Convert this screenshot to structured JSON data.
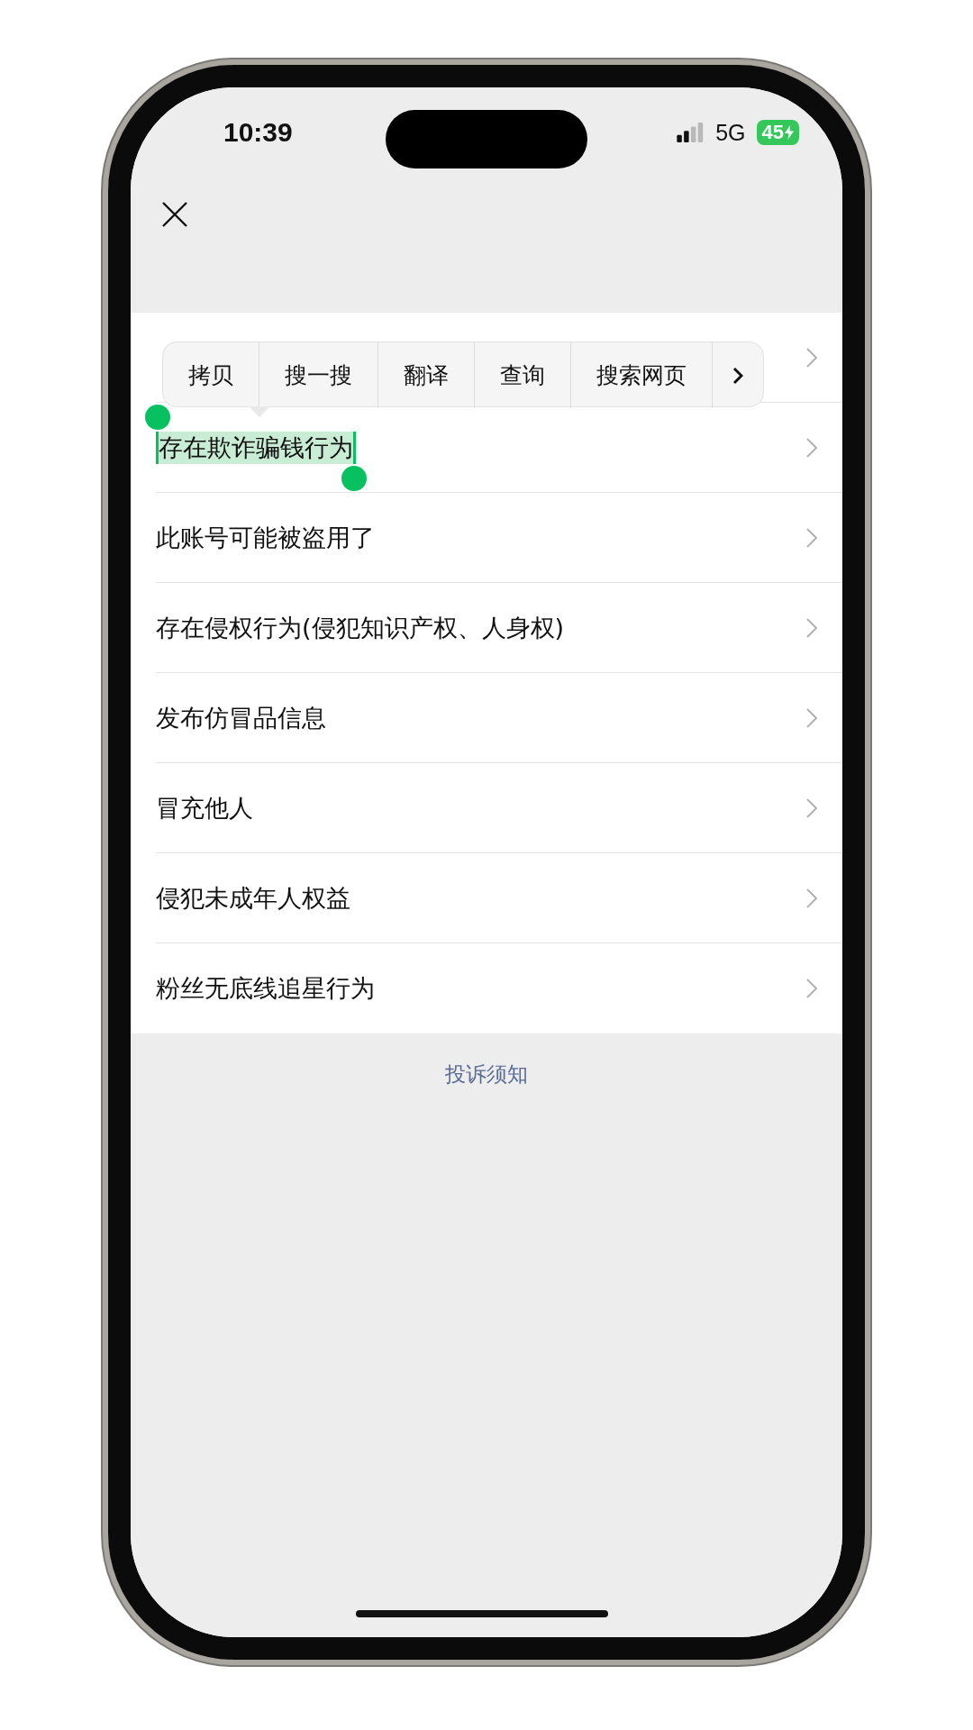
{
  "status_bar": {
    "time": "10:39",
    "network": "5G",
    "battery": "45"
  },
  "reasons": [
    {
      "selected": false
    },
    {
      "label": "存在欺诈骗钱行为",
      "selected": true
    },
    {
      "label": "此账号可能被盗用了",
      "selected": false
    },
    {
      "label": "存在侵权行为(侵犯知识产权、人身权)",
      "selected": false
    },
    {
      "label": "发布仿冒品信息",
      "selected": false
    },
    {
      "label": "冒充他人",
      "selected": false
    },
    {
      "label": "侵犯未成年人权益",
      "selected": false
    },
    {
      "label": "粉丝无底线追星行为",
      "selected": false
    }
  ],
  "context_menu": {
    "items": [
      "拷贝",
      "搜一搜",
      "翻译",
      "查询",
      "搜索网页"
    ],
    "has_more": true
  },
  "footer_link": "投诉须知"
}
